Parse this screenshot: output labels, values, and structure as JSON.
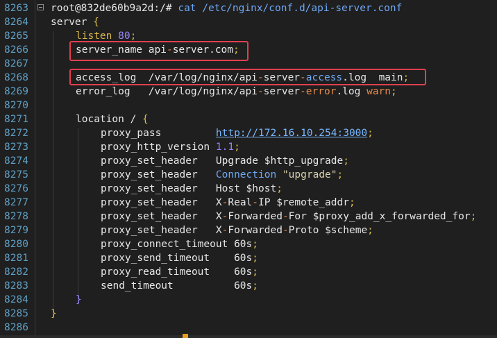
{
  "terminal": {
    "line_numbers": [
      "8263",
      "8264",
      "8265",
      "8266",
      "8267",
      "8268",
      "8269",
      "8270",
      "8271",
      "8272",
      "8273",
      "8274",
      "8275",
      "8276",
      "8277",
      "8278",
      "8279",
      "8280",
      "8281",
      "8282",
      "8283",
      "8284",
      "8285",
      "8286"
    ],
    "prompt": "root@832de60b9a2d:/#",
    "command": "cat /etc/nginx/conf.d/api-server.conf",
    "code": {
      "server_open": "server",
      "brace_open": "{",
      "listen_kw": "listen",
      "listen_val": "80",
      "semicolon": ";",
      "server_name_kw": "server_name",
      "server_name_val1": "api",
      "dash": "-",
      "server_name_val2": "server.com",
      "access_log_kw": "access_log",
      "access_path1": "/var/log/nginx/api",
      "access_path2": "server",
      "access_path3": "access",
      "access_path4": ".log",
      "access_format": "main",
      "error_log_kw": "error_log",
      "error_path1": "/var/log/nginx/api",
      "error_path2": "server",
      "error_path3": "error",
      "error_path4": ".log",
      "error_level": "warn",
      "location_kw": "location",
      "location_path": "/",
      "proxy_pass_kw": "proxy_pass",
      "proxy_pass_url": "http://172.16.10.254:3000",
      "proxy_http_version_kw": "proxy_http_version",
      "proxy_http_version_val": "1.1",
      "proxy_set_header_kw": "proxy_set_header",
      "h1_name": "Upgrade",
      "h1_val": "$http_upgrade",
      "h2_name": "Connection",
      "h2_val": "\"upgrade\"",
      "h3_name": "Host",
      "h3_val": "$host",
      "h4_name": "X",
      "h4_name2": "Real",
      "h4_name3": "IP",
      "h4_val": "$remote_addr",
      "h5_name": "X",
      "h5_name2": "Forwarded",
      "h5_name3": "For",
      "h5_val": "$proxy_add_x_forwarded_for",
      "h6_name": "X",
      "h6_name2": "Forwarded",
      "h6_name3": "Proto",
      "h6_val": "$scheme",
      "connect_timeout_kw": "proxy_connect_timeout",
      "connect_timeout_val": "60s",
      "send_timeout_kw": "proxy_send_timeout",
      "send_timeout_val": "60s",
      "read_timeout_kw": "proxy_read_timeout",
      "read_timeout_val": "60s",
      "send_timeout2_kw": "send_timeout",
      "send_timeout2_val": "60s",
      "brace_close": "}"
    }
  },
  "colors": {
    "background": "#1f1f1f",
    "line_number": "#5fa0c6",
    "highlight_box": "#e0404f",
    "keyword_yellow": "#d9b84a",
    "number_purple": "#9c85ff",
    "accent_orange": "#e5894c",
    "link_blue": "#79b7ff"
  }
}
